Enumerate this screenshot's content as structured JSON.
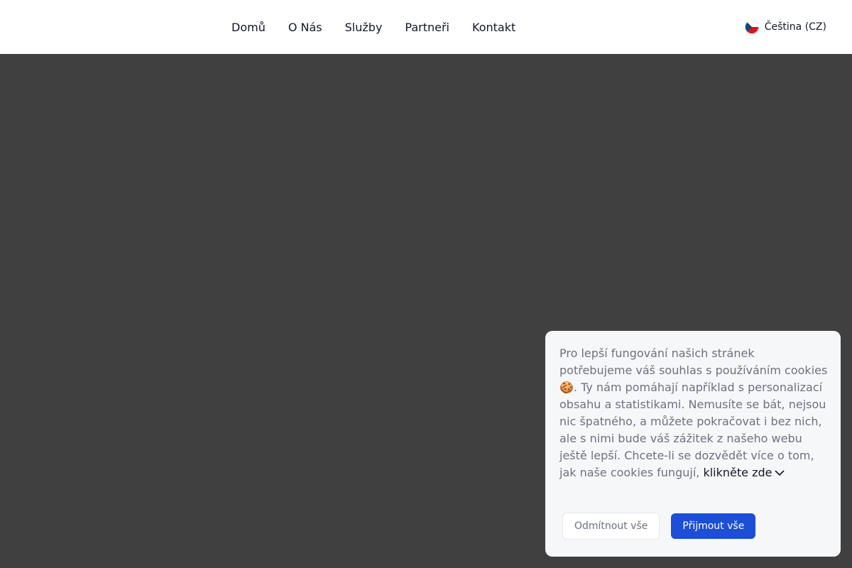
{
  "header": {
    "nav": [
      {
        "label": "Domů"
      },
      {
        "label": "O Nás"
      },
      {
        "label": "Služby"
      },
      {
        "label": "Partneři"
      },
      {
        "label": "Kontakt"
      }
    ],
    "language": {
      "label": "Čeština (CZ)",
      "flag_icon": "czech-flag-icon"
    }
  },
  "cookie_banner": {
    "text": "Pro lepší fungování našich stránek potřebujeme váš souhlas s používáním cookies 🍪. Ty nám pomáhají například s personalizací obsahu a statistikami. Nemusíte se bát, nejsou nic špatného, a můžete pokračovat i bez nich, ale s nimi bude váš zážitek z našeho webu ještě lepší. Chcete-li se dozvědět více o tom, jak naše cookies fungují,",
    "link_label": "klikněte zde",
    "link_icon": "chevron-down-icon",
    "reject_label": "Odmítnout vše",
    "accept_label": "Přijmout vše"
  },
  "colors": {
    "background": "#404040",
    "header": "#ffffff",
    "banner": "#f6f7f9",
    "accent": "#1d4ed8",
    "text_muted": "#6b7280",
    "text_dark": "#111827"
  }
}
